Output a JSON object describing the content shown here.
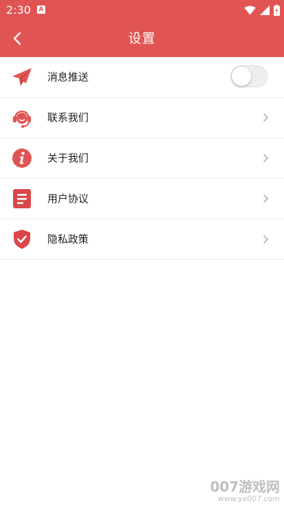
{
  "status_bar": {
    "time": "2:30",
    "notification_glyph": "A",
    "icons": [
      "wifi-icon",
      "signal-icon",
      "battery-icon"
    ]
  },
  "header": {
    "title": "设置",
    "back_icon": "chevron-left-icon",
    "background": "#e05554"
  },
  "settings_list": [
    {
      "label": "消息推送",
      "icon": "paper-plane-icon",
      "control": "toggle",
      "toggle_on": false
    },
    {
      "label": "联系我们",
      "icon": "headset-support-icon",
      "control": "chevron"
    },
    {
      "label": "关于我们",
      "icon": "info-icon",
      "control": "chevron"
    },
    {
      "label": "用户协议",
      "icon": "document-icon",
      "control": "chevron"
    },
    {
      "label": "隐私政策",
      "icon": "shield-check-icon",
      "control": "chevron"
    }
  ],
  "watermark": {
    "main": "007游戏网",
    "sub": "www.yx007.com"
  },
  "colors": {
    "accent": "#e05554",
    "divider": "#ececec",
    "chevron": "#a8a8a8"
  }
}
